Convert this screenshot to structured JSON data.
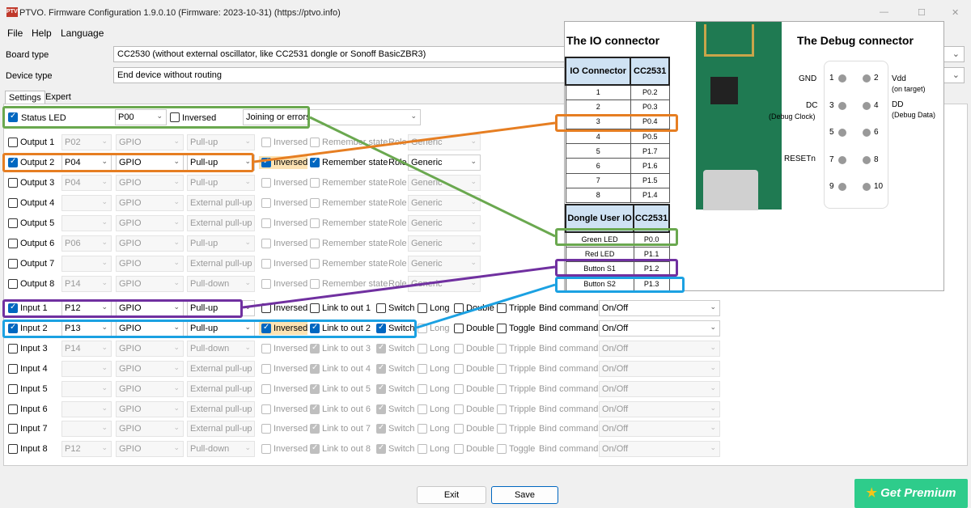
{
  "window": {
    "title": "PTVO. Firmware Configuration 1.9.0.10 (Firmware: 2023-10-31) (https://ptvo.info)",
    "icon_text": "PTVO"
  },
  "menu": [
    "File",
    "Help",
    "Language"
  ],
  "board": {
    "label": "Board type",
    "value": "CC2530 (without external oscillator, like CC2531 dongle or Sonoff BasicZBR3)"
  },
  "device": {
    "label": "Device type",
    "value": "End device without routing"
  },
  "tabs": [
    "Settings",
    "Expert"
  ],
  "status_led": {
    "label": "Status LED",
    "pin": "P00",
    "inversed": "Inversed",
    "mode": "Joining or errors"
  },
  "outputs": [
    {
      "label": "Output 1",
      "pin": "P02",
      "type": "GPIO",
      "pull": "Pull-up",
      "inv": "Inversed",
      "rem": "Remember state",
      "role_label": "Role",
      "role": "Generic"
    },
    {
      "label": "Output 2",
      "pin": "P04",
      "type": "GPIO",
      "pull": "Pull-up",
      "inv": "Inversed",
      "rem": "Remember state",
      "role_label": "Role",
      "role": "Generic"
    },
    {
      "label": "Output 3",
      "pin": "P04",
      "type": "GPIO",
      "pull": "Pull-up",
      "inv": "Inversed",
      "rem": "Remember state",
      "role_label": "Role",
      "role": "Generic"
    },
    {
      "label": "Output 4",
      "pin": "",
      "type": "GPIO",
      "pull": "External pull-up",
      "inv": "Inversed",
      "rem": "Remember state",
      "role_label": "Role",
      "role": "Generic"
    },
    {
      "label": "Output 5",
      "pin": "",
      "type": "GPIO",
      "pull": "External pull-up",
      "inv": "Inversed",
      "rem": "Remember state",
      "role_label": "Role",
      "role": "Generic"
    },
    {
      "label": "Output 6",
      "pin": "P06",
      "type": "GPIO",
      "pull": "Pull-up",
      "inv": "Inversed",
      "rem": "Remember state",
      "role_label": "Role",
      "role": "Generic"
    },
    {
      "label": "Output 7",
      "pin": "",
      "type": "GPIO",
      "pull": "External pull-up",
      "inv": "Inversed",
      "rem": "Remember state",
      "role_label": "Role",
      "role": "Generic"
    },
    {
      "label": "Output 8",
      "pin": "P14",
      "type": "GPIO",
      "pull": "Pull-down",
      "inv": "Inversed",
      "rem": "Remember state",
      "role_label": "Role",
      "role": "Generic"
    }
  ],
  "inputs": [
    {
      "label": "Input 1",
      "pin": "P12",
      "type": "GPIO",
      "pull": "Pull-up",
      "inv": "Inversed",
      "link": "Link to out 1",
      "sw": "Switch",
      "long": "Long",
      "dbl": "Double",
      "tr": "Tripple",
      "bind": "Bind command",
      "cmd": "On/Off"
    },
    {
      "label": "Input 2",
      "pin": "P13",
      "type": "GPIO",
      "pull": "Pull-up",
      "inv": "Inversed",
      "link": "Link to out 2",
      "sw": "Switch",
      "long": "Long",
      "dbl": "Double",
      "tr": "Toggle",
      "bind": "Bind command",
      "cmd": "On/Off"
    },
    {
      "label": "Input 3",
      "pin": "P14",
      "type": "GPIO",
      "pull": "Pull-down",
      "inv": "Inversed",
      "link": "Link to out 3",
      "sw": "Switch",
      "long": "Long",
      "dbl": "Double",
      "tr": "Tripple",
      "bind": "Bind command",
      "cmd": "On/Off"
    },
    {
      "label": "Input 4",
      "pin": "",
      "type": "GPIO",
      "pull": "External pull-up",
      "inv": "Inversed",
      "link": "Link to out 4",
      "sw": "Switch",
      "long": "Long",
      "dbl": "Double",
      "tr": "Tripple",
      "bind": "Bind command",
      "cmd": "On/Off"
    },
    {
      "label": "Input 5",
      "pin": "",
      "type": "GPIO",
      "pull": "External pull-up",
      "inv": "Inversed",
      "link": "Link to out 5",
      "sw": "Switch",
      "long": "Long",
      "dbl": "Double",
      "tr": "Tripple",
      "bind": "Bind command",
      "cmd": "On/Off"
    },
    {
      "label": "Input 6",
      "pin": "",
      "type": "GPIO",
      "pull": "External pull-up",
      "inv": "Inversed",
      "link": "Link to out 6",
      "sw": "Switch",
      "long": "Long",
      "dbl": "Double",
      "tr": "Tripple",
      "bind": "Bind command",
      "cmd": "On/Off"
    },
    {
      "label": "Input 7",
      "pin": "",
      "type": "GPIO",
      "pull": "External pull-up",
      "inv": "Inversed",
      "link": "Link to out 7",
      "sw": "Switch",
      "long": "Long",
      "dbl": "Double",
      "tr": "Tripple",
      "bind": "Bind command",
      "cmd": "On/Off"
    },
    {
      "label": "Input 8",
      "pin": "P12",
      "type": "GPIO",
      "pull": "Pull-down",
      "inv": "Inversed",
      "link": "Link to out 8",
      "sw": "Switch",
      "long": "Long",
      "dbl": "Double",
      "tr": "Toggle",
      "bind": "Bind command",
      "cmd": "On/Off"
    }
  ],
  "buttons": {
    "exit": "Exit",
    "save": "Save",
    "premium": "Get Premium"
  },
  "overlay": {
    "io_title": "The IO connector",
    "debug_title": "The Debug connector",
    "io_header": [
      "IO Connector",
      "CC2531"
    ],
    "io_rows": [
      [
        "1",
        "P0.2"
      ],
      [
        "2",
        "P0.3"
      ],
      [
        "3",
        "P0.4"
      ],
      [
        "4",
        "P0.5"
      ],
      [
        "5",
        "P1.7"
      ],
      [
        "6",
        "P1.6"
      ],
      [
        "7",
        "P1.5"
      ],
      [
        "8",
        "P1.4"
      ]
    ],
    "dongle_header": [
      "Dongle User IO",
      "CC2531"
    ],
    "dongle_rows": [
      [
        "Green LED",
        "P0.0"
      ],
      [
        "Red LED",
        "P1.1"
      ],
      [
        "Button S1",
        "P1.2"
      ],
      [
        "Button S2",
        "P1.3"
      ]
    ],
    "debug": {
      "gnd": "GND",
      "vdd": "Vdd",
      "vdd_sub": "(on target)",
      "dc": "DC",
      "dc_sub": "(Debug Clock)",
      "dd": "DD",
      "dd_sub": "(Debug Data)",
      "reset": "RESETn",
      "pins": [
        "1",
        "2",
        "3",
        "4",
        "5",
        "6",
        "7",
        "8",
        "9",
        "10"
      ]
    }
  },
  "colors": {
    "green": "#6aa84f",
    "orange": "#e67e22",
    "purple": "#7030a0",
    "blue": "#1ba1e2",
    "accent": "#0067c0"
  }
}
